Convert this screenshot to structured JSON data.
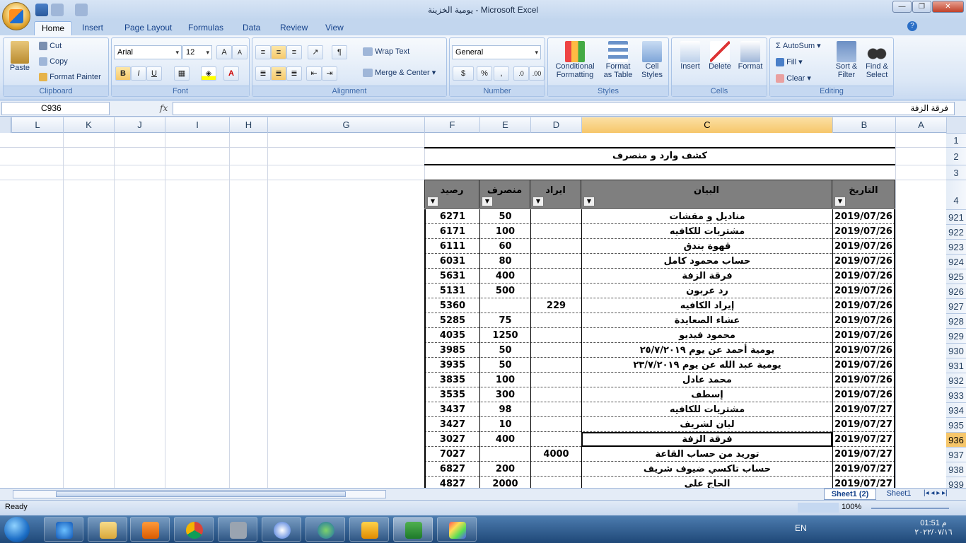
{
  "window": {
    "title": "يومية الخزينة - Microsoft Excel"
  },
  "tabs": [
    "Home",
    "Insert",
    "Page Layout",
    "Formulas",
    "Data",
    "Review",
    "View"
  ],
  "clipboard": {
    "paste": "Paste",
    "cut": "Cut",
    "copy": "Copy",
    "format_painter": "Format Painter",
    "label": "Clipboard"
  },
  "font": {
    "name": "Arial",
    "size": "12",
    "label": "Font",
    "bold": "B",
    "italic": "I",
    "underline": "U",
    "color": "A"
  },
  "alignment": {
    "wrap": "Wrap Text",
    "merge": "Merge & Center",
    "label": "Alignment"
  },
  "number": {
    "format": "General",
    "label": "Number",
    "percent": "%",
    "comma": ","
  },
  "styles": {
    "conditional": "Conditional\nFormatting",
    "format_table": "Format\nas Table",
    "cell_styles": "Cell\nStyles",
    "label": "Styles"
  },
  "cells": {
    "insert": "Insert",
    "delete": "Delete",
    "format": "Format",
    "label": "Cells"
  },
  "editing": {
    "autosum": "AutoSum",
    "fill": "Fill",
    "clear": "Clear",
    "sort": "Sort &\nFilter",
    "find": "Find &\nSelect",
    "label": "Editing"
  },
  "formula_bar": {
    "name_box": "C936",
    "fx": "fx",
    "content": "فرقة الزفة"
  },
  "columns": [
    "L",
    "K",
    "J",
    "I",
    "H",
    "G",
    "F",
    "E",
    "D",
    "C",
    "B",
    "A"
  ],
  "sheet": {
    "title": "كشف وارد و منصرف",
    "headers": {
      "date": "التاريخ",
      "desc": "البيان",
      "income": "ايراد",
      "expense": "منصرف",
      "balance": "رصيد"
    },
    "top_rows": [
      "1",
      "2",
      "3",
      "4"
    ],
    "rows": [
      {
        "n": "921",
        "date": "2019/07/26",
        "desc": "مناديل و مقشات",
        "income": "",
        "expense": "50",
        "balance": "6271"
      },
      {
        "n": "922",
        "date": "2019/07/26",
        "desc": "مشتريات للكافيه",
        "income": "",
        "expense": "100",
        "balance": "6171"
      },
      {
        "n": "923",
        "date": "2019/07/26",
        "desc": "قهوة بندق",
        "income": "",
        "expense": "60",
        "balance": "6111"
      },
      {
        "n": "924",
        "date": "2019/07/26",
        "desc": "حساب محمود كامل",
        "income": "",
        "expense": "80",
        "balance": "6031"
      },
      {
        "n": "925",
        "date": "2019/07/26",
        "desc": "فرقة الزفة",
        "income": "",
        "expense": "400",
        "balance": "5631"
      },
      {
        "n": "926",
        "date": "2019/07/26",
        "desc": "رد عربون",
        "income": "",
        "expense": "500",
        "balance": "5131"
      },
      {
        "n": "927",
        "date": "2019/07/26",
        "desc": "إيراد الكافيه",
        "income": "229",
        "expense": "",
        "balance": "5360"
      },
      {
        "n": "928",
        "date": "2019/07/26",
        "desc": "عشاء الصعايدة",
        "income": "",
        "expense": "75",
        "balance": "5285"
      },
      {
        "n": "929",
        "date": "2019/07/26",
        "desc": "محمود فيديو",
        "income": "",
        "expense": "1250",
        "balance": "4035"
      },
      {
        "n": "930",
        "date": "2019/07/26",
        "desc": "يومية أحمد عن يوم ٢٥/٧/٢٠١٩",
        "income": "",
        "expense": "50",
        "balance": "3985"
      },
      {
        "n": "931",
        "date": "2019/07/26",
        "desc": "يومية عبد الله عن يوم ٢٣/٧/٢٠١٩",
        "income": "",
        "expense": "50",
        "balance": "3935"
      },
      {
        "n": "932",
        "date": "2019/07/26",
        "desc": "محمد عادل",
        "income": "",
        "expense": "100",
        "balance": "3835"
      },
      {
        "n": "933",
        "date": "2019/07/26",
        "desc": "إسطف",
        "income": "",
        "expense": "300",
        "balance": "3535"
      },
      {
        "n": "934",
        "date": "2019/07/27",
        "desc": "مشتريات للكافيه",
        "income": "",
        "expense": "98",
        "balance": "3437"
      },
      {
        "n": "935",
        "date": "2019/07/27",
        "desc": "لبان لشريف",
        "income": "",
        "expense": "10",
        "balance": "3427"
      },
      {
        "n": "936",
        "date": "2019/07/27",
        "desc": "فرقة الزفة",
        "income": "",
        "expense": "400",
        "balance": "3027"
      },
      {
        "n": "937",
        "date": "2019/07/27",
        "desc": "توريد من حساب القاعة",
        "income": "4000",
        "expense": "",
        "balance": "7027"
      },
      {
        "n": "938",
        "date": "2019/07/27",
        "desc": "حساب تاكسي ضيوف شريف",
        "income": "",
        "expense": "200",
        "balance": "6827"
      },
      {
        "n": "939",
        "date": "2019/07/27",
        "desc": "الحاج علي",
        "income": "",
        "expense": "2000",
        "balance": "4827"
      }
    ]
  },
  "sheet_tabs": [
    "Sheet1 (2)",
    "Sheet1"
  ],
  "status": {
    "ready": "Ready",
    "zoom": "100%"
  },
  "taskbar": {
    "lang": "EN",
    "time": "01:51 م",
    "date": "٢٠٢٢/٠٧/١٦"
  },
  "icons": [
    "office-logo-icon",
    "save-icon",
    "undo-icon",
    "redo-icon",
    "help-icon",
    "minimize-icon",
    "restore-icon",
    "close-icon",
    "paste-icon",
    "cut-icon",
    "copy-icon",
    "format-painter-icon",
    "filter-dropdown-icon",
    "start-orb-icon",
    "ie-icon",
    "folder-icon",
    "media-player-icon",
    "chrome-icon",
    "excel-icon"
  ]
}
